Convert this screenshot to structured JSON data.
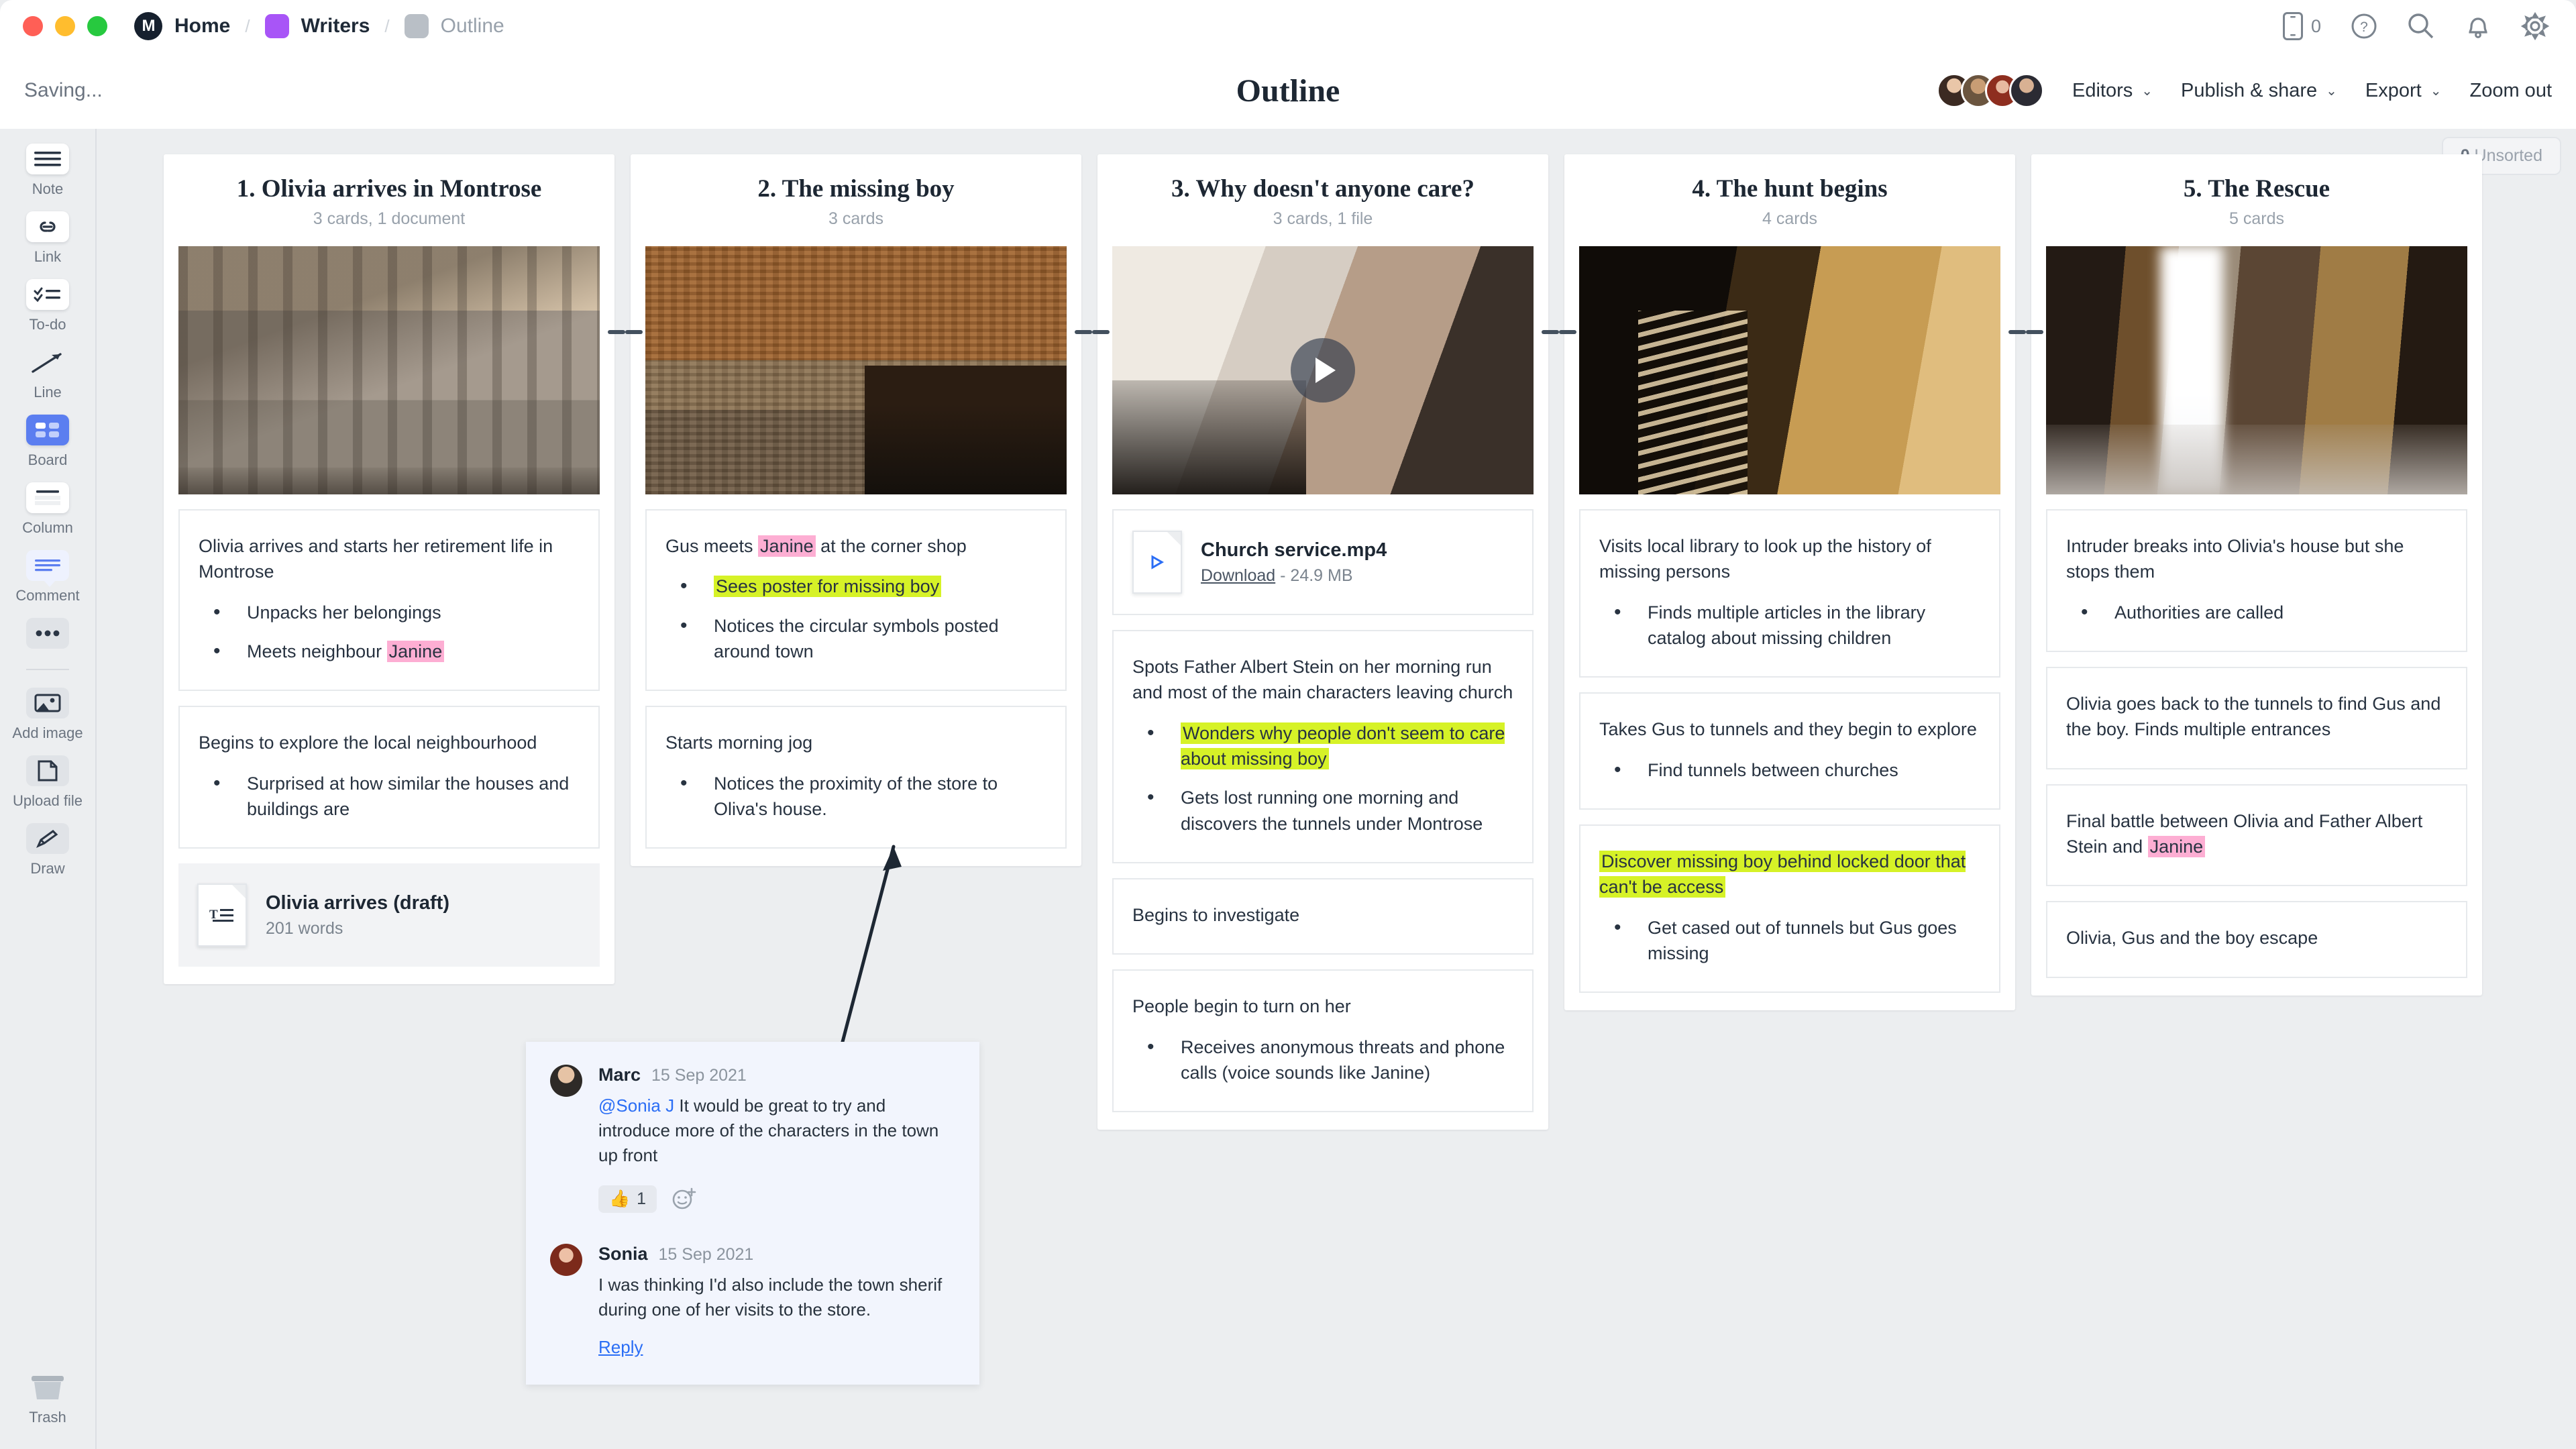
{
  "titlebar": {
    "breadcrumbs": [
      {
        "label": "Home",
        "swatch": "#16202e",
        "dim": false
      },
      {
        "label": "Writers",
        "swatch": "#a855f7",
        "dim": false
      },
      {
        "label": "Outline",
        "swatch": "#b9bfc6",
        "dim": true
      }
    ],
    "logo_glyph": "M",
    "device_count": "0",
    "icons": [
      "mobile-preview-icon",
      "help-icon",
      "search-icon",
      "notifications-icon",
      "settings-icon"
    ]
  },
  "subheader": {
    "status": "Saving...",
    "doc_title": "Outline",
    "menus": [
      {
        "label": "Editors",
        "caret": "⌄"
      },
      {
        "label": "Publish & share",
        "caret": "⌄"
      },
      {
        "label": "Export",
        "caret": "⌄"
      }
    ],
    "zoom_out": "Zoom out"
  },
  "rail": {
    "tools": [
      {
        "label": "Note",
        "icon": "note-icon"
      },
      {
        "label": "Link",
        "icon": "link-icon"
      },
      {
        "label": "To-do",
        "icon": "todo-icon"
      },
      {
        "label": "Line",
        "icon": "line-arrow-icon"
      },
      {
        "label": "Board",
        "icon": "board-icon",
        "active": true
      },
      {
        "label": "Column",
        "icon": "column-icon"
      },
      {
        "label": "Comment",
        "icon": "comment-icon"
      },
      {
        "label": "",
        "icon": "more-dots-icon"
      },
      {
        "label": "Add image",
        "icon": "image-icon"
      },
      {
        "label": "Upload file",
        "icon": "file-icon"
      },
      {
        "label": "Draw",
        "icon": "pencil-icon"
      }
    ],
    "trash_label": "Trash",
    "trash_icon": "trash-icon"
  },
  "canvas": {
    "unsorted_count": "0",
    "unsorted_label": "Unsorted"
  },
  "columns": [
    {
      "title": "1. Olivia arrives in Montrose",
      "meta": "3 cards, 1 document",
      "image": "vintage-street-photo",
      "cards": [
        {
          "type": "note",
          "heading": [
            {
              "t": "Olivia arrives and starts her retirement life in Montrose"
            }
          ],
          "bullets": [
            [
              {
                "t": "Unpacks her belongings"
              }
            ],
            [
              {
                "t": "Meets neighbour "
              },
              {
                "t": "Janine",
                "hl": "pink"
              }
            ]
          ]
        },
        {
          "type": "note",
          "heading": [
            {
              "t": "Begins to explore the local neighbourhood"
            }
          ],
          "bullets": [
            [
              {
                "t": "Surprised at how similar the houses and buildings are"
              }
            ]
          ]
        },
        {
          "type": "doc",
          "name": "Olivia arrives (draft)",
          "sub": "201 words",
          "glyph": "text-doc-icon"
        }
      ]
    },
    {
      "title": "2. The missing boy",
      "meta": "3 cards",
      "image": "brick-shopfront-photo",
      "cards": [
        {
          "type": "note",
          "heading": [
            {
              "t": "Gus meets "
            },
            {
              "t": "Janine",
              "hl": "pink"
            },
            {
              "t": " at the corner shop"
            }
          ],
          "bullets": [
            [
              {
                "t": "Sees poster for missing boy",
                "hl": "green"
              }
            ],
            [
              {
                "t": "Notices the circular symbols posted around town"
              }
            ]
          ]
        },
        {
          "type": "note",
          "heading": [
            {
              "t": "Starts morning jog"
            }
          ],
          "bullets": [
            [
              {
                "t": "Notices the proximity of the store to Oliva's house."
              }
            ]
          ]
        }
      ]
    },
    {
      "title": "3. Why doesn't anyone care?",
      "meta": "3 cards, 1 file",
      "image": "woman-praying-video-thumb",
      "has_video": true,
      "cards": [
        {
          "type": "file",
          "name": "Church service.mp4",
          "download_label": "Download",
          "size": "24.9 MB",
          "glyph": "video-file-icon"
        },
        {
          "type": "note",
          "heading": [
            {
              "t": "Spots Father Albert Stein on her morning run and most of the main characters leaving church"
            }
          ],
          "bullets": [
            [
              {
                "t": "Wonders why people don't seem to care about missing boy",
                "hl": "green"
              }
            ],
            [
              {
                "t": "Gets lost running one morning and discovers the tunnels under Montrose"
              }
            ]
          ]
        },
        {
          "type": "note",
          "heading": [
            {
              "t": "Begins to investigate"
            }
          ],
          "bullets": []
        },
        {
          "type": "note",
          "heading": [
            {
              "t": "People begin to turn on her"
            }
          ],
          "bullets": [
            [
              {
                "t": "Receives anonymous threats and phone calls (voice sounds like Janine)"
              }
            ]
          ]
        }
      ]
    },
    {
      "title": "4. The hunt begins",
      "meta": "4 cards",
      "image": "underground-stairs-to-street-photo",
      "cards": [
        {
          "type": "note",
          "heading": [
            {
              "t": "Visits local library to look up the history of missing persons"
            }
          ],
          "bullets": [
            [
              {
                "t": "Finds multiple articles in the library catalog about missing children"
              }
            ]
          ]
        },
        {
          "type": "note",
          "heading": [
            {
              "t": "Takes Gus to tunnels and they begin to explore"
            }
          ],
          "bullets": [
            [
              {
                "t": "Find tunnels between churches"
              }
            ]
          ]
        },
        {
          "type": "note",
          "heading": [
            {
              "t": "Discover missing boy behind locked door that can't be access",
              "hl": "green"
            }
          ],
          "bullets": [
            [
              {
                "t": "Get cased out of tunnels but Gus goes missing"
              }
            ]
          ]
        }
      ]
    },
    {
      "title": "5. The Rescue",
      "meta": "5 cards",
      "image": "cave-waterfall-light-photo",
      "cards": [
        {
          "type": "note",
          "heading": [
            {
              "t": "Intruder breaks into Olivia's house but she stops them"
            }
          ],
          "bullets": [
            [
              {
                "t": "Authorities are called"
              }
            ]
          ]
        },
        {
          "type": "note",
          "heading": [
            {
              "t": "Olivia goes back to the tunnels to find Gus and the boy. Finds multiple entrances"
            }
          ],
          "bullets": []
        },
        {
          "type": "note",
          "heading": [
            {
              "t": "Final battle between Olivia and Father Albert Stein and "
            },
            {
              "t": "Janine",
              "hl": "pink"
            }
          ],
          "bullets": []
        },
        {
          "type": "note",
          "heading": [
            {
              "t": "Olivia, Gus and the boy escape"
            }
          ],
          "bullets": []
        }
      ]
    }
  ],
  "comment_thread": {
    "comments": [
      {
        "author": "Marc",
        "date": "15 Sep 2021",
        "avatar": "avatar-marc",
        "mention": "@Sonia J",
        "body": " It would be great to try and introduce more of the characters in the town up front",
        "reaction_emoji": "👍",
        "reaction_count": "1",
        "add_reaction_icon": "add-reaction-icon"
      },
      {
        "author": "Sonia",
        "date": "15 Sep 2021",
        "avatar": "avatar-sonia",
        "mention": "",
        "body": "I was thinking I'd also include the town sherif during one of her visits to the store.",
        "reply_label": "Reply"
      }
    ]
  },
  "colors": {
    "accent": "#5b7ef0",
    "link": "#2b6ef5",
    "highlight_pink": "#fdaed3",
    "highlight_green": "#d6f227",
    "text": "#283341",
    "muted": "#98a1ab",
    "canvas_bg": "#eceef0"
  }
}
